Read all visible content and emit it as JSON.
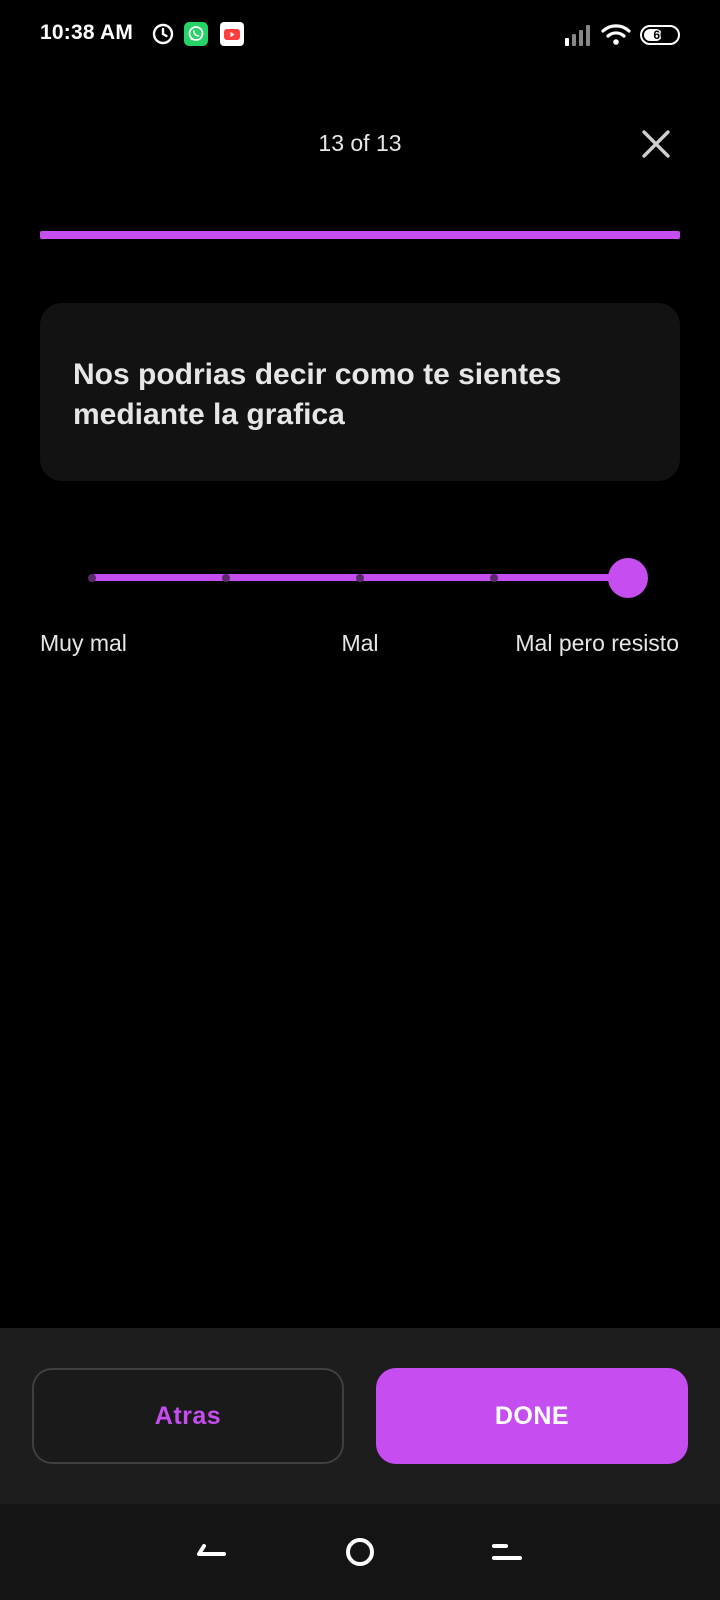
{
  "status_bar": {
    "time": "10:38 AM",
    "icons": [
      "alarm-icon",
      "whatsapp-icon",
      "youtube-icon",
      "signal-icon",
      "wifi-icon"
    ],
    "battery_level": "60",
    "battery_fraction": 0.6
  },
  "header": {
    "progress_text": "13 of 13",
    "close_icon": "close-icon",
    "progress_fraction": 1.0
  },
  "question": {
    "text": "Nos podrias decir como te sientes mediante la grafica"
  },
  "slider": {
    "steps": 5,
    "selected_index": 4,
    "labels": {
      "left": "Muy mal",
      "center": "Mal",
      "right": "Mal pero resisto"
    }
  },
  "actions": {
    "back_label": "Atras",
    "done_label": "DONE"
  },
  "nav_bar": {
    "icons": [
      "nav-back-icon",
      "nav-home-icon",
      "nav-recents-icon"
    ]
  },
  "colors": {
    "accent": "#c64df0",
    "background": "#000000",
    "card": "#121212",
    "bottom_bar": "#1d1d1d"
  }
}
